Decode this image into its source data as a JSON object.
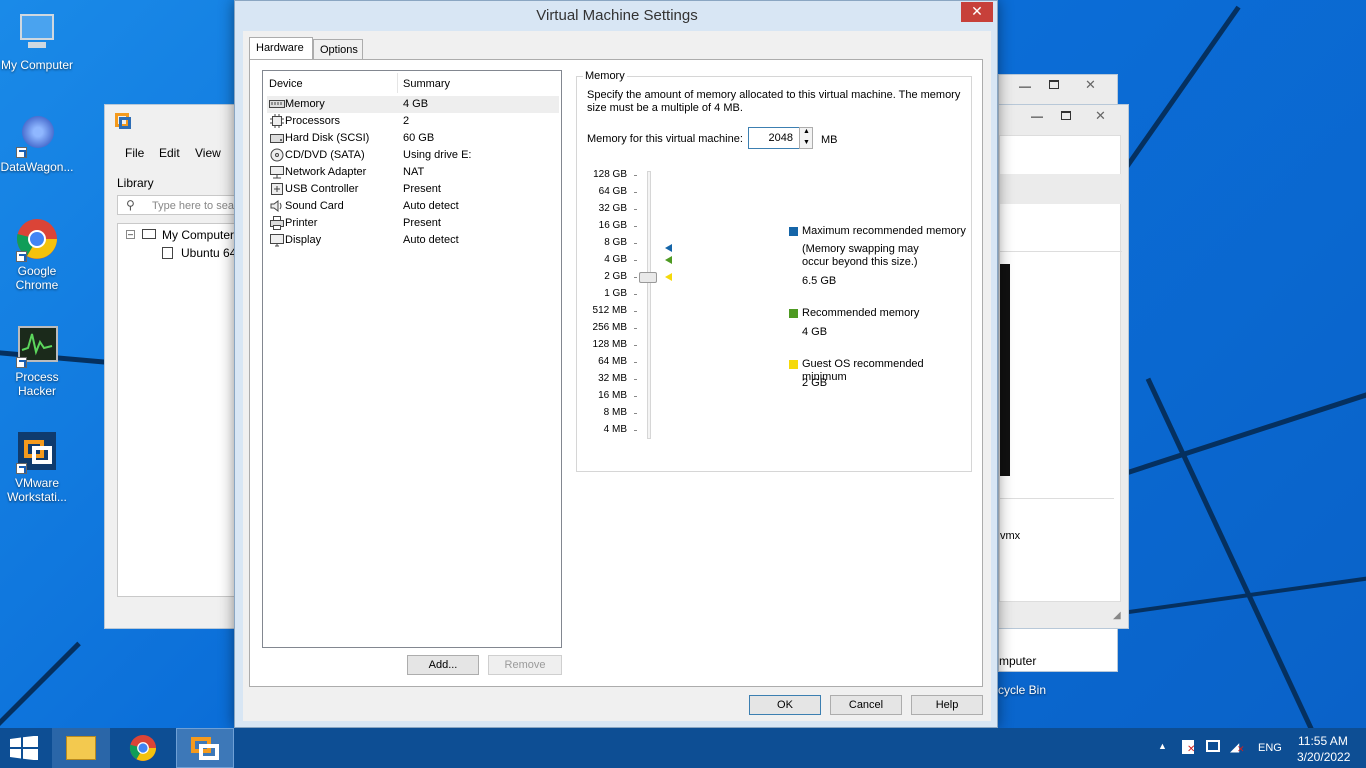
{
  "desktop": {
    "icons": [
      {
        "label": "My Computer"
      },
      {
        "label": "DataWagon..."
      },
      {
        "label": "Google Chrome"
      },
      {
        "label": "Process Hacker"
      },
      {
        "label": "VMware Workstati..."
      }
    ]
  },
  "bg_vmware": {
    "menu": [
      "File",
      "Edit",
      "View"
    ],
    "library_label": "Library",
    "search_placeholder": "Type here to sea",
    "tree": [
      "My Computer",
      "Ubuntu 64"
    ]
  },
  "bg_right": {
    "text_vmx": "vmx",
    "text_computer": "mputer",
    "text_recycle": "cycle Bin"
  },
  "dialog": {
    "title": "Virtual Machine Settings",
    "close": "✕",
    "tabs": [
      "Hardware",
      "Options"
    ],
    "device_header": "Device",
    "summary_header": "Summary",
    "devices": [
      {
        "name": "Memory",
        "summary": "4 GB",
        "icon": "memory-icon"
      },
      {
        "name": "Processors",
        "summary": "2",
        "icon": "processor-icon"
      },
      {
        "name": "Hard Disk (SCSI)",
        "summary": "60 GB",
        "icon": "hard-disk-icon"
      },
      {
        "name": "CD/DVD (SATA)",
        "summary": "Using drive E:",
        "icon": "cd-dvd-icon"
      },
      {
        "name": "Network Adapter",
        "summary": "NAT",
        "icon": "network-adapter-icon"
      },
      {
        "name": "USB Controller",
        "summary": "Present",
        "icon": "usb-icon"
      },
      {
        "name": "Sound Card",
        "summary": "Auto detect",
        "icon": "sound-card-icon"
      },
      {
        "name": "Printer",
        "summary": "Present",
        "icon": "printer-icon"
      },
      {
        "name": "Display",
        "summary": "Auto detect",
        "icon": "display-icon"
      }
    ],
    "add_button": "Add...",
    "remove_button": "Remove",
    "memory": {
      "group_label": "Memory",
      "description": "Specify the amount of memory allocated to this virtual machine. The memory size must be a multiple of 4 MB.",
      "field_label": "Memory for this virtual machine:",
      "value": "2048",
      "unit": "MB",
      "ticks": [
        "128 GB",
        "64 GB",
        "32 GB",
        "16 GB",
        "8 GB",
        "4 GB",
        "2 GB",
        "1 GB",
        "512 MB",
        "256 MB",
        "128 MB",
        "64 MB",
        "32 MB",
        "16 MB",
        "8 MB",
        "4 MB"
      ],
      "legend": {
        "max_title": "Maximum recommended memory",
        "max_note_1": "(Memory swapping may",
        "max_note_2": "occur beyond this size.)",
        "max_value": "6.5 GB",
        "rec_title": "Recommended memory",
        "rec_value": "4 GB",
        "guest_title": "Guest OS recommended minimum",
        "guest_value": "2 GB"
      },
      "colors": {
        "max": "#1565a8",
        "recommended": "#4e9a22",
        "guest": "#f5d90a"
      }
    },
    "ok_button": "OK",
    "cancel_button": "Cancel",
    "help_button": "Help"
  },
  "taskbar": {
    "language": "ENG",
    "time": "11:55 AM",
    "date": "3/20/2022"
  }
}
